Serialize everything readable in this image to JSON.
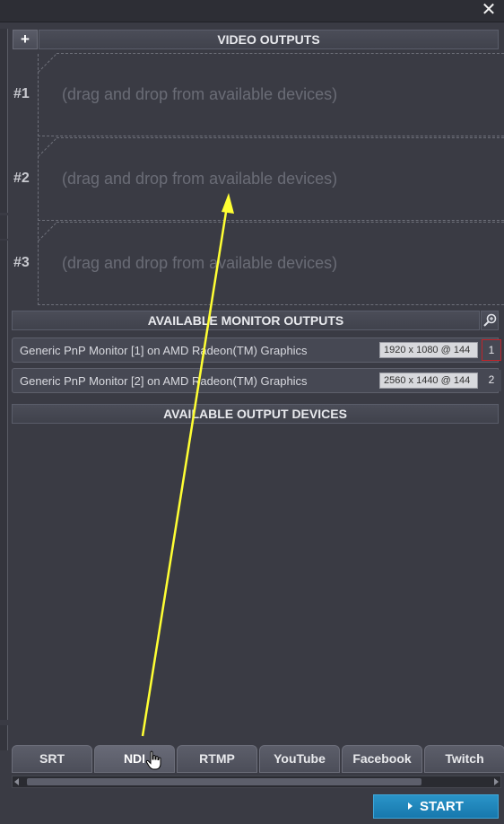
{
  "window": {
    "close_glyph": "✕"
  },
  "video_outputs": {
    "add_label": "+",
    "header": "VIDEO OUTPUTS",
    "slots": [
      {
        "number": "#1",
        "placeholder": "(drag and drop from available devices)"
      },
      {
        "number": "#2",
        "placeholder": "(drag and drop from available devices)"
      },
      {
        "number": "#3",
        "placeholder": "(drag and drop from available devices)"
      }
    ]
  },
  "monitor_outputs": {
    "header": "AVAILABLE MONITOR OUTPUTS",
    "search_icon": "search-icon",
    "items": [
      {
        "name": "Generic PnP Monitor [1] on AMD Radeon(TM) Graphics",
        "resolution": "1920 x 1080 @ 144",
        "index": "1",
        "selected": true
      },
      {
        "name": "Generic PnP Monitor [2] on AMD Radeon(TM) Graphics",
        "resolution": "2560 x 1440 @ 144",
        "index": "2",
        "selected": false
      }
    ]
  },
  "output_devices": {
    "header": "AVAILABLE OUTPUT DEVICES"
  },
  "tabs": [
    {
      "label": "SRT",
      "active": false
    },
    {
      "label": "NDI",
      "active": true
    },
    {
      "label": "RTMP",
      "active": false
    },
    {
      "label": "YouTube",
      "active": false
    },
    {
      "label": "Facebook",
      "active": false
    },
    {
      "label": "Twitch",
      "active": false
    }
  ],
  "start_button": {
    "label": "START"
  },
  "colors": {
    "background": "#3a3b44",
    "accent": "#1e86bb",
    "selected_border": "#c0242a",
    "annotation_arrow": "#ffff33"
  }
}
